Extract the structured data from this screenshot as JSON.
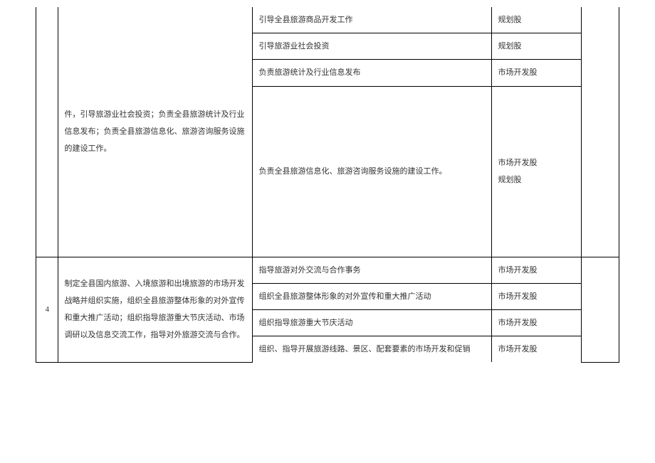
{
  "section3": {
    "desc": "件，引导旅游业社会投资；负责全县旅游统计及行业信息发布；负责全县旅游信息化、旅游咨询服务设施的建设工作。",
    "rows": [
      {
        "detail": "引导全县旅游商品开发工作",
        "dept": "规划股"
      },
      {
        "detail": "引导旅游业社会投资",
        "dept": "规划股"
      },
      {
        "detail": "负责旅游统计及行业信息发布",
        "dept": "市场开发股"
      },
      {
        "detail": "负责全县旅游信息化、旅游咨询服务设施的建设工作。",
        "dept": "市场开发股\n规划股"
      }
    ]
  },
  "section4": {
    "num": "4",
    "desc": "制定全县国内旅游、入境旅游和出境旅游的市场开发战略并组织实施，组织全县旅游整体形象的对外宣传和重大推广活动；组织指导旅游重大节庆活动、市场调研以及信息交流工作，指导对外旅游交流与合作。",
    "rows": [
      {
        "detail": "指导旅游对外交流与合作事务",
        "dept": "市场开发股"
      },
      {
        "detail": "组织全县旅游整体形象的对外宣传和重大推广活动",
        "dept": "市场开发股"
      },
      {
        "detail": "组织指导旅游重大节庆活动",
        "dept": "市场开发股"
      },
      {
        "detail": "组织、指导开展旅游线路、景区、配套要素的市场开发和促销",
        "dept": "市场开发股"
      }
    ]
  }
}
